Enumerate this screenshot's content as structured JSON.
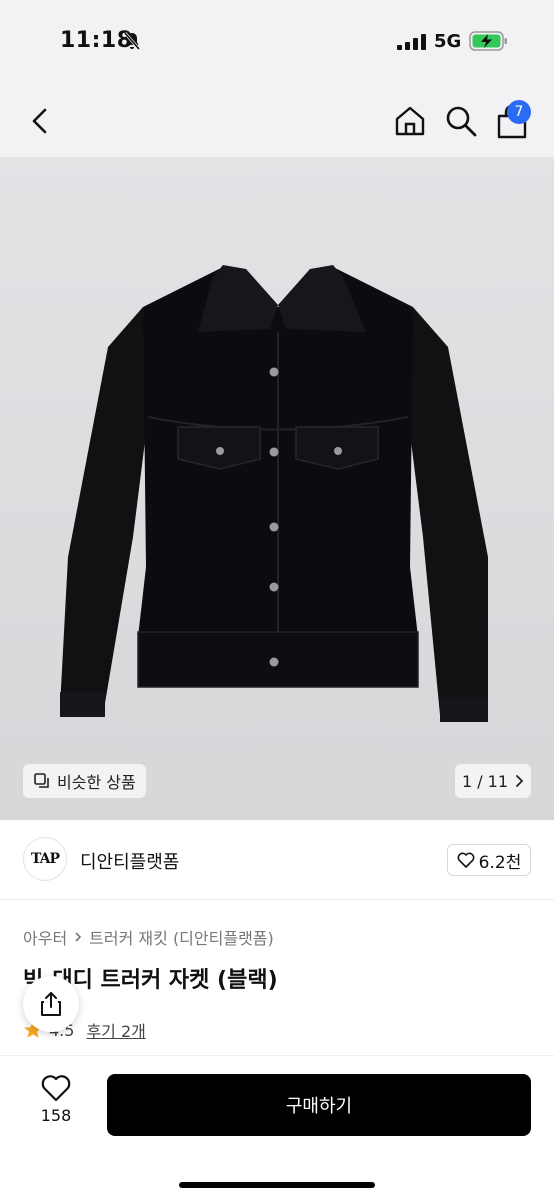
{
  "status": {
    "time": "11:18",
    "network": "5G"
  },
  "header": {
    "cart_count": "7"
  },
  "gallery": {
    "similar_label": "비슷한 상품",
    "page_indicator": "1 / 11"
  },
  "brand": {
    "logo_text": "TAP",
    "name": "디안티플랫폼",
    "like_count": "6.2천"
  },
  "product": {
    "breadcrumb": [
      "아우터",
      "트러커 재킷 (디안티플랫폼)"
    ],
    "title": "빅-대디 트러커 자켓 (블랙)",
    "rating": "4.5",
    "review_label": "후기 2개"
  },
  "bottom": {
    "wish_count": "158",
    "buy_label": "구매하기"
  },
  "colors": {
    "accent": "#2b6cf6",
    "buy_button": "#000000",
    "star": "#f5a623",
    "battery": "#34c759"
  }
}
